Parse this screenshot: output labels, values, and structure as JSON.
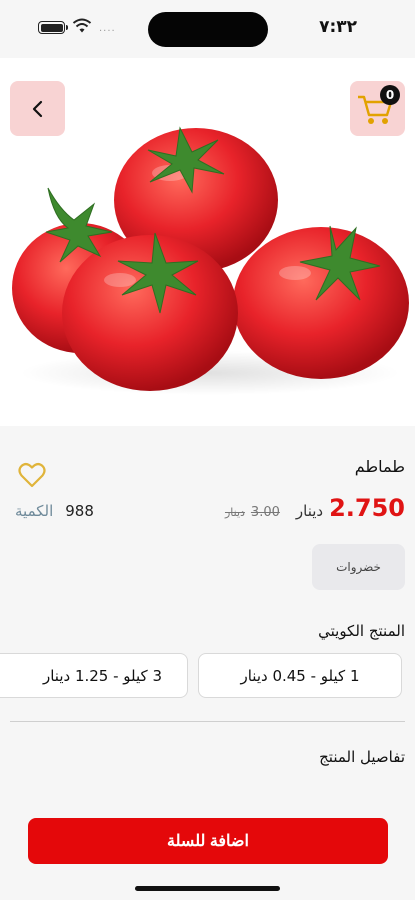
{
  "status_bar": {
    "time": "٧:٣٢",
    "signal_dots": "...."
  },
  "header": {
    "cart_count": "0"
  },
  "product": {
    "name": "طماطم",
    "price": "2.750",
    "currency": "دينار",
    "old_price": "3.00",
    "old_currency": "دينار",
    "quantity_value": "988",
    "quantity_label": "الكمية",
    "category": "خضروات",
    "origin": "المنتج الكويتي",
    "details_title": "تفاصيل المنتج"
  },
  "options": [
    {
      "label": "1 كيلو - 0.45  دينار"
    },
    {
      "label": "3 كيلو - 1.25  دينار"
    }
  ],
  "actions": {
    "add_to_cart": "اضافة للسلة"
  },
  "colors": {
    "accent": "#e4080a",
    "icon_bg": "#f8d3d3",
    "heart": "#e0b43a"
  },
  "icons": [
    "back-chevron-icon",
    "cart-icon",
    "heart-icon",
    "battery-icon",
    "wifi-icon"
  ]
}
